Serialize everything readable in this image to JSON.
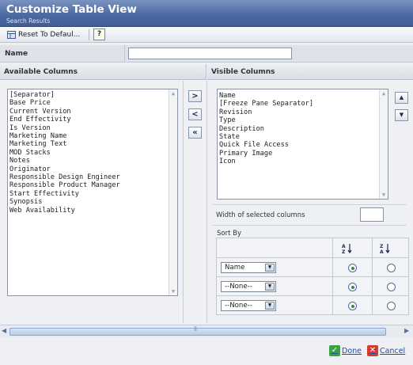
{
  "header": {
    "title": "Customize Table View",
    "subtitle": "Search Results"
  },
  "toolbar": {
    "reset_label": "Reset To Defaul...",
    "help_label": "?"
  },
  "name_field": {
    "label": "Name",
    "value": ""
  },
  "available": {
    "heading": "Available Columns",
    "items": [
      "[Separator]",
      "Base Price",
      "Current Version",
      "End Effectivity",
      "Is Version",
      "Marketing Name",
      "Marketing Text",
      "MOD Stacks",
      "Notes",
      "Originator",
      "Responsible Design Engineer",
      "Responsible Product Manager",
      "Start Effectivity",
      "Synopsis",
      "Web Availability"
    ]
  },
  "move_buttons": {
    "add": ">",
    "remove": "<",
    "remove_all": "«"
  },
  "visible": {
    "heading": "Visible Columns",
    "items": [
      "Name",
      "[Freeze Pane Separator]",
      "Revision",
      "Type",
      "Description",
      "State",
      "Quick File Access",
      "Primary Image",
      "Icon"
    ],
    "up": "▲",
    "down": "▼"
  },
  "width": {
    "label": "Width of selected columns",
    "value": ""
  },
  "sort": {
    "label": "Sort By",
    "rows": [
      {
        "field": "Name",
        "ascending": true
      },
      {
        "field": "--None--",
        "ascending": true
      },
      {
        "field": "--None--",
        "ascending": true
      }
    ]
  },
  "footer": {
    "done_label": "Done",
    "cancel_label": "Cancel"
  },
  "colors": {
    "header": "#4d6aa2",
    "done_green": "#3aa33f",
    "cancel_red": "#d43a2f",
    "link": "#1e4fa8"
  }
}
